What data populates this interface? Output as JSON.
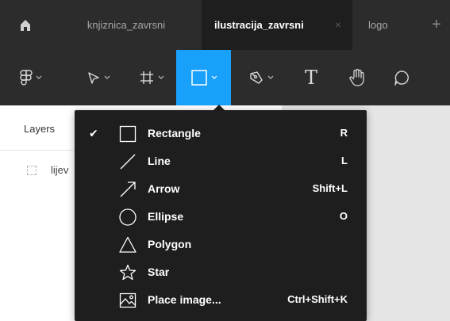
{
  "tabs": [
    {
      "label": "knjiznica_zavrsni",
      "active": false
    },
    {
      "label": "ilustracija_zavrsni",
      "active": true,
      "close": "×"
    },
    {
      "label": "logo",
      "active": false
    }
  ],
  "tab_add": "+",
  "toolbar": {
    "tools": [
      "main-menu",
      "move",
      "frame",
      "shape",
      "pen",
      "text",
      "hand",
      "comment"
    ],
    "active_tool": "shape",
    "text_tool_glyph": "T",
    "accent": "#18a0fb"
  },
  "layers": {
    "title": "Layers",
    "items": [
      {
        "label": "lijev"
      }
    ]
  },
  "menu": {
    "check_glyph": "✔",
    "items": [
      {
        "label": "Rectangle",
        "shortcut": "R",
        "checked": true,
        "icon": "rectangle-icon"
      },
      {
        "label": "Line",
        "shortcut": "L",
        "checked": false,
        "icon": "line-icon"
      },
      {
        "label": "Arrow",
        "shortcut": "Shift+L",
        "checked": false,
        "icon": "arrow-icon"
      },
      {
        "label": "Ellipse",
        "shortcut": "O",
        "checked": false,
        "icon": "ellipse-icon"
      },
      {
        "label": "Polygon",
        "shortcut": "",
        "checked": false,
        "icon": "polygon-icon"
      },
      {
        "label": "Star",
        "shortcut": "",
        "checked": false,
        "icon": "star-icon"
      },
      {
        "label": "Place image...",
        "shortcut": "Ctrl+Shift+K",
        "checked": false,
        "icon": "place-image-icon"
      }
    ]
  }
}
